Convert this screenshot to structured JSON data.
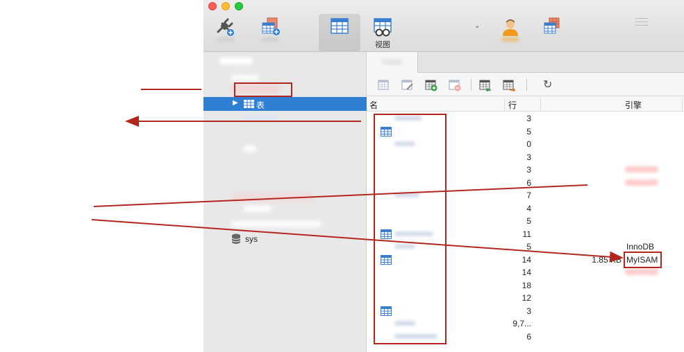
{
  "toolbar": {
    "view_label": "视图"
  },
  "sidebar": {
    "selected_item_label": "表",
    "sys_label": "sys"
  },
  "table": {
    "columns": {
      "name": "名",
      "rows": "行",
      "engine": "引擎"
    },
    "rows": [
      {
        "rows": "3",
        "icon": false,
        "size": "",
        "engine": ""
      },
      {
        "rows": "5",
        "icon": true,
        "size": "",
        "engine": ""
      },
      {
        "rows": "0",
        "icon": false,
        "size": "",
        "engine": ""
      },
      {
        "rows": "3",
        "icon": false,
        "size": "",
        "engine": ""
      },
      {
        "rows": "3",
        "icon": false,
        "size": "",
        "engine": ""
      },
      {
        "rows": "6",
        "icon": false,
        "size": "",
        "engine": ""
      },
      {
        "rows": "7",
        "icon": false,
        "size": "",
        "engine": ""
      },
      {
        "rows": "4",
        "icon": false,
        "size": "",
        "engine": ""
      },
      {
        "rows": "5",
        "icon": false,
        "size": "",
        "engine": ""
      },
      {
        "rows": "11",
        "icon": true,
        "size": "",
        "engine": ""
      },
      {
        "rows": "5",
        "icon": false,
        "size": "",
        "engine": "InnoDB"
      },
      {
        "rows": "14",
        "icon": true,
        "size": "1.85 KB",
        "engine": "MyISAM"
      },
      {
        "rows": "14",
        "icon": false,
        "size": "",
        "engine": ""
      },
      {
        "rows": "18",
        "icon": false,
        "size": "",
        "engine": ""
      },
      {
        "rows": "12",
        "icon": false,
        "size": "",
        "engine": ""
      },
      {
        "rows": "3",
        "icon": true,
        "size": "",
        "engine": ""
      },
      {
        "rows": "9,7...",
        "icon": false,
        "size": "",
        "engine": ""
      },
      {
        "rows": "6",
        "icon": false,
        "size": "",
        "engine": ""
      }
    ]
  },
  "colors": {
    "selection": "#2f7fd4",
    "annotation": "#b3261e",
    "table_icon": "#3a7fcf"
  },
  "icons": [
    "plug-icon",
    "new-table-icon",
    "table-icon",
    "view-icon",
    "user-icon",
    "schedule-icon",
    "database-icon",
    "refresh-icon"
  ]
}
